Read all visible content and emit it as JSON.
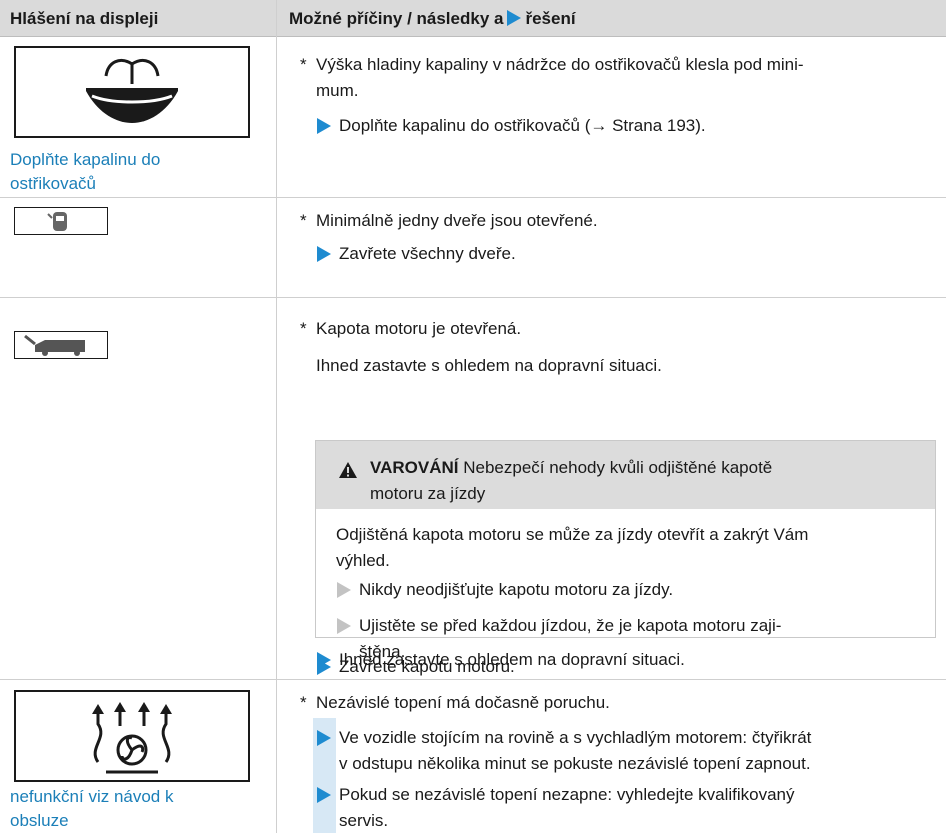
{
  "header": {
    "col1": "Hlášení na displeji",
    "col2_prefix": "Možné příčiny / následky a",
    "col2_suffix": "řešení"
  },
  "rows": {
    "washer": {
      "label_1": "Doplňte kapalinu do",
      "label_2": "ostřikovačů",
      "cause_1": "Výška hladiny kapaliny v nádržce do ostřikovačů klesla pod mini-",
      "cause_2": "mum.",
      "action_1": "Doplňte kapalinu do ostřikovačů (→ Strana 193)."
    },
    "door": {
      "cause_1": "Minimálně jedny dveře jsou otevřené.",
      "action_1": "Zavřete všechny dveře."
    },
    "hood": {
      "cause_1": "Kapota motoru je otevřená.",
      "cause_2": "Ihned zastavte s ohledem na dopravní situaci.",
      "warning": {
        "title": "VAROVÁNÍ",
        "head_1": "Nebezpečí nehody kvůli odjištěné kapotě",
        "head_2": "motoru za jízdy",
        "body_1": "Odjištěná kapota motoru se může za jízdy otevřít a zakrýt Vám",
        "body_2": "výhled.",
        "item_1": "Nikdy neodjišťujte kapotu motoru za jízdy.",
        "item_2_1": "Ujistěte se před každou jízdou, že je kapota motoru zaji-",
        "item_2_2": "štěna."
      },
      "action_1": "Ihned zastavte s ohledem na dopravní situaci.",
      "action_2": "Zavřete kapotu motoru."
    },
    "heater": {
      "label_1": "nefunkční viz návod k",
      "label_2": "obsluze",
      "cause_1": "Nezávislé topení má dočasně poruchu.",
      "action_1_1": "Ve vozidle stojícím na rovině a s vychladlým motorem: čtyřikrát",
      "action_1_2": "v odstupu několika minut se pokuste nezávislé topení zapnout.",
      "action_2_1": "Pokud se nezávislé topení nezapne: vyhledejte kvalifikovaný",
      "action_2_2": "servis."
    }
  },
  "symbols": {
    "star": "*"
  },
  "colors": {
    "accent": "#1e8bd0",
    "header_bg": "#dadada",
    "label_blue": "#1b7fb8",
    "bar": "#d7e8f5"
  }
}
